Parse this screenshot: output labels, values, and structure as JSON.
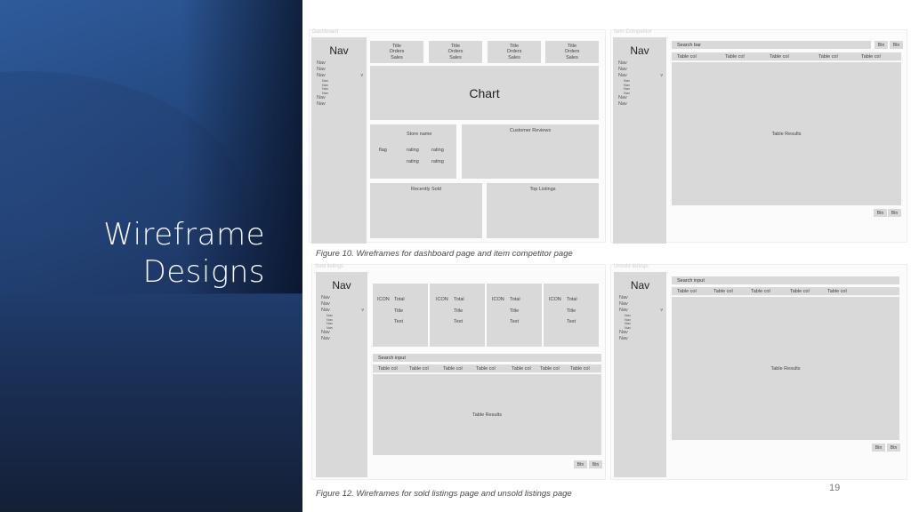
{
  "slide": {
    "title_line1": "Wireframe",
    "title_line2": "Designs",
    "page_number": "19"
  },
  "captions": {
    "figure10": "Figure 10. Wireframes for dashboard page and item competitor page",
    "figure12": "Figure 12. Wireframes for sold listings page and unsold listings page"
  },
  "nav": {
    "title": "Nav",
    "items": [
      "Nav",
      "Nav",
      "Nav"
    ],
    "expand_glyph": "v",
    "subitems": [
      "Nav",
      "Nav",
      "Nav",
      "Nav"
    ],
    "items_after": [
      "Nav",
      "Nav"
    ]
  },
  "dashboard": {
    "label": "Dashboard",
    "stat_cards": [
      {
        "line1": "Title",
        "line2": "Orders",
        "line3": "Sales"
      },
      {
        "line1": "Title",
        "line2": "Orders",
        "line3": "Sales"
      },
      {
        "line1": "Title",
        "line2": "Orders",
        "line3": "Sales"
      },
      {
        "line1": "Title",
        "line2": "Orders",
        "line3": "Sales"
      }
    ],
    "chart_label": "Chart",
    "store": {
      "name": "Store name",
      "flag": "flag",
      "ratings": [
        "rating",
        "rating",
        "rating",
        "rating"
      ]
    },
    "customer_reviews": "Customer Reviews",
    "recently_sold": "Recently Sold",
    "top_listings": "Top Listings"
  },
  "item_competitor": {
    "label": "Item Competitor",
    "search_placeholder": "Search bar",
    "top_buttons": [
      "Btn",
      "Btn"
    ],
    "columns": [
      "Table col",
      "Table col",
      "Table col",
      "Table col",
      "Table col"
    ],
    "results": "Table Results",
    "bottom_buttons": [
      "Btn",
      "Btn"
    ]
  },
  "sold_listings": {
    "label": "Sold listings",
    "cards": [
      {
        "icon": "ICON",
        "total": "Total",
        "title": "Title",
        "text": "Text"
      },
      {
        "icon": "ICON",
        "total": "Total",
        "title": "Title",
        "text": "Text"
      },
      {
        "icon": "ICON",
        "total": "Total",
        "title": "Title",
        "text": "Text"
      },
      {
        "icon": "ICON",
        "total": "Total",
        "title": "Title",
        "text": "Text"
      }
    ],
    "search_placeholder": "Search input",
    "columns": [
      "Table col",
      "Table col",
      "Table col",
      "Table col",
      "Table col",
      "Table col",
      "Table col"
    ],
    "results": "Table Results",
    "bottom_buttons": [
      "Btn",
      "Btn"
    ]
  },
  "unsold_listings": {
    "label": "Unsold listings",
    "search_placeholder": "Search input",
    "columns": [
      "Table col",
      "Table col",
      "Table col",
      "Table col",
      "Table col"
    ],
    "results": "Table Results",
    "bottom_buttons": [
      "Btn",
      "Btn"
    ]
  }
}
